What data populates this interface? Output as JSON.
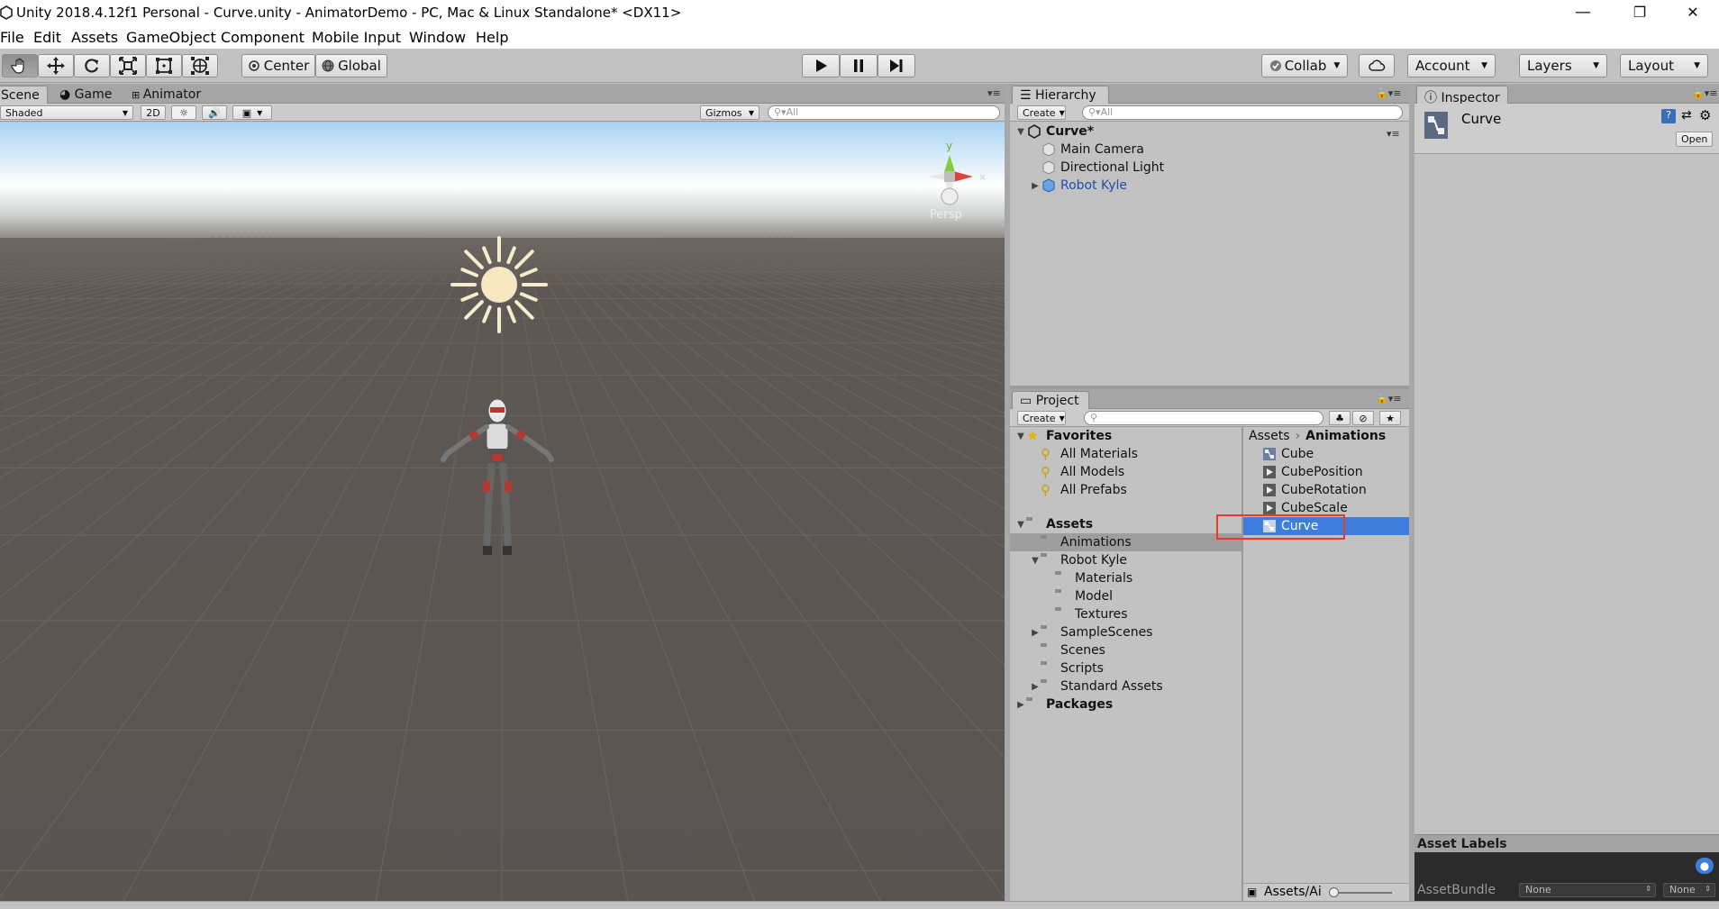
{
  "window": {
    "title": "Unity 2018.4.12f1 Personal - Curve.unity - AnimatorDemo - PC, Mac & Linux Standalone* <DX11>",
    "minimize": "—",
    "restore": "❐",
    "close": "✕"
  },
  "menu": [
    "File",
    "Edit",
    "Assets",
    "GameObject",
    "Component",
    "Mobile Input",
    "Window",
    "Help"
  ],
  "toolbar": {
    "center_label": "Center",
    "global_label": "Global",
    "collab_label": "Collab",
    "account_label": "Account",
    "layers_label": "Layers",
    "layout_label": "Layout",
    "tools": [
      "hand-tool",
      "move-tool",
      "rotate-tool",
      "scale-tool",
      "rect-tool",
      "transform-tool"
    ],
    "playback": [
      "play",
      "pause",
      "step"
    ]
  },
  "scene_panel": {
    "tabs": [
      "Scene",
      "Game",
      "Animator"
    ],
    "shading": "Shaded",
    "mode_2d": "2D",
    "gizmos_label": "Gizmos",
    "search_placeholder": "All",
    "persp_label": "Persp",
    "gizmo_y_label": "y"
  },
  "hierarchy": {
    "tab": "Hierarchy",
    "create_label": "Create",
    "search_placeholder": "All",
    "scene_name": "Curve*",
    "items": [
      "Main Camera",
      "Directional Light",
      "Robot Kyle"
    ]
  },
  "project": {
    "tab": "Project",
    "create_label": "Create",
    "favorites_label": "Favorites",
    "favorites": [
      "All Materials",
      "All Models",
      "All Prefabs"
    ],
    "assets_label": "Assets",
    "assets_tree": {
      "animations": "Animations",
      "robot_kyle": "Robot Kyle",
      "materials": "Materials",
      "model": "Model",
      "textures": "Textures",
      "sample_scenes": "SampleScenes",
      "scenes": "Scenes",
      "scripts": "Scripts",
      "standard_assets": "Standard Assets"
    },
    "packages_label": "Packages",
    "breadcrumb": [
      "Assets",
      "Animations"
    ],
    "files": [
      "Cube",
      "CubePosition",
      "CubeRotation",
      "CubeScale",
      "Curve"
    ],
    "selected_file": "Curve",
    "footer_path": "Assets/Ai"
  },
  "inspector": {
    "tab": "Inspector",
    "object_name": "Curve",
    "open_label": "Open",
    "asset_labels": "Asset Labels",
    "asset_bundle_label": "AssetBundle",
    "bundle_value": "None",
    "variant_value": "None"
  },
  "colors": {
    "selection_blue": "#3d7ddb",
    "highlight_red": "#e53935",
    "sky_top": "#aed6f5",
    "ground": "#5b5653"
  }
}
